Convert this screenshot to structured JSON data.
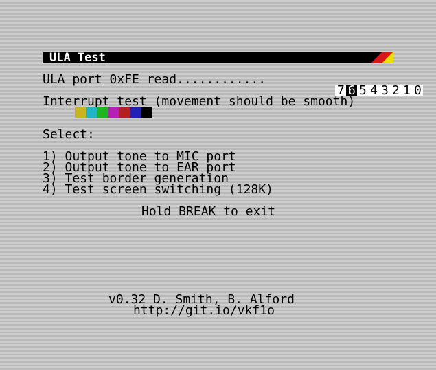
{
  "title": "ULA Test",
  "stripe_colors": [
    "#d81818",
    "#e8e000",
    "#18c018",
    "#20d0d8"
  ],
  "port_read": {
    "label": "ULA port 0xFE read............",
    "bits": [
      "7",
      "6",
      "5",
      "4",
      "3",
      "2",
      "1",
      "0"
    ],
    "inverted_bit_index": 1
  },
  "interrupt": {
    "label": "Interrupt test (movement should be smooth)",
    "bar_colors": [
      "#c8b420",
      "#20b4c8",
      "#20b420",
      "#b420b4",
      "#b42020",
      "#2020b4",
      "#000000"
    ]
  },
  "select_label": "Select:",
  "options": [
    "1) Output tone to MIC port",
    "2) Output tone to EAR port",
    "3) Test border generation",
    "4) Test screen switching (128K)"
  ],
  "exit_hint": "Hold BREAK to exit",
  "credits": {
    "version": "v0.32 D. Smith, B. Alford",
    "url": "http://git.io/vkf1o"
  }
}
